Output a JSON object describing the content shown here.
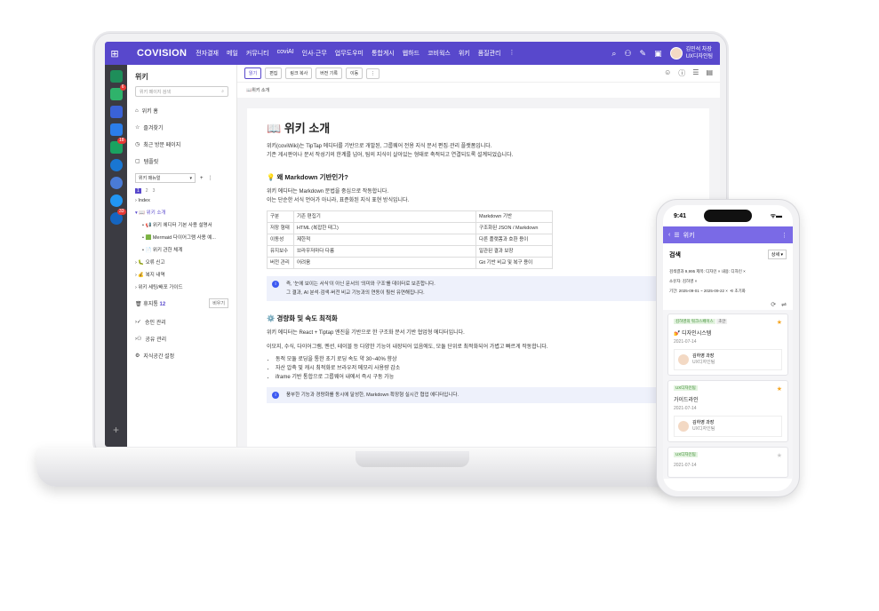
{
  "app": {
    "logo": "COVISION",
    "menu": [
      "전자결재",
      "메일",
      "커뮤니티",
      "coviAI",
      "인사·근무",
      "업무도우미",
      "통합게시",
      "웹하드",
      "코비웍스",
      "위키",
      "품질관리"
    ],
    "more": "⋮",
    "user_name": "김민석 차장",
    "user_dept": "UX디자인팀",
    "accent": "#5848cc"
  },
  "dock": {
    "badges": [
      "6",
      "18",
      "33"
    ]
  },
  "nav": {
    "title": "위키",
    "search_placeholder": "위키 페이지 검색",
    "items": [
      "위키 홈",
      "즐겨찾기",
      "최근 방문 페이지",
      "템플릿"
    ],
    "menu_select": "위키 매뉴얼",
    "pages": [
      "1",
      "2",
      "3"
    ],
    "tree": [
      "Index",
      "위키 소개",
      "위키 에디터 기본 사용 설명서",
      "Mermaid 다이어그램 사용 예...",
      "위키 관한 체계",
      "오류 신고",
      "복지 내역",
      "위키 세팅/배포 가이드"
    ],
    "trash_label": "휴지통",
    "trash_count": "12",
    "trash_button": "비우기",
    "bottom_items": [
      "승인 관리",
      "공유 관리",
      "지식공간 설정"
    ]
  },
  "toolbar": {
    "buttons": [
      "읽기",
      "편집",
      "링크 복사",
      "버전 기록",
      "이동"
    ],
    "more": "⋮"
  },
  "breadcrumb": "위키 소개",
  "doc": {
    "title": "위키 소개",
    "intro1": "위키(coviWiki)는 TipTap 에디터를 기반으로 개발된, 그룹웨어 전용 지식 문서 편집·관리 플랫폼입니다.",
    "intro2": "기존 게시판이나 문서 작성기의 한계를 넘어, 팀의 지식이 살아있는 형태로 축적되고 연결되도록 설계되었습니다.",
    "h_markdown": "왜 Markdown 기반인가?",
    "md1": "위키 에디터는 Markdown 문법을 중심으로 작동합니다.",
    "md2": "이는 단순한 서식 언어가 아니라, 표준화된 지식 표현 방식입니다.",
    "table": [
      [
        "구분",
        "기존 편집기",
        "Markdown 기반"
      ],
      [
        "저장 형태",
        "HTML (복잡한 태그)",
        "구조화된 JSON / Markdown"
      ],
      [
        "이동성",
        "제한적",
        "다른 플랫폼과 호환 용이"
      ],
      [
        "유지보수",
        "브라우저마다 다름",
        "일관된 결과 보장"
      ],
      [
        "버전 관리",
        "어려움",
        "Git 기반 비교 및 복구 용이"
      ]
    ],
    "note1a": "즉, '눈에 보이는 서식'이 아닌 문서의 '의미와 구조'를 데이터로 보존합니다.",
    "note1b": "그 결과, AI 분석·검색·버전 비교 기능과의 연동이 훨씬 유연해집니다.",
    "h_speed": "경량화 및 속도 최적화",
    "sp1": "위키 에디터는 React + Tiptap 엔진을 기반으로 한 구조화 문서 기반 협업형 에디터입니다.",
    "sp2": "이모지, 수식, 다이어그램, 멘션, 테이블 등 다양한 기능이 내장되어 있음에도, 모듈 단위로 최적화되어 가볍고 빠르게 작동합니다.",
    "bullets": [
      "동적 모듈 로딩을 통한 초기 로딩 속도 약 30~40% 향상",
      "자산 압축 및 캐시 최적화로 브라우저 메모리 사용량 감소",
      "iframe 기반 통합으로 그룹웨어 내에서 즉시 구동 가능"
    ],
    "note2": "풍부한 기능과 경량화를 동시에 달성한, Markdown 확장형 실시간 협업 에디터입니다."
  },
  "phone": {
    "time": "9:41",
    "header_title": "위키",
    "page_title": "검색",
    "detail_select": "상세",
    "result_line": "검색결과 9,995  제목: 디자인 ×  내용: 디자인 ×",
    "owner_line": "소유자: 김하영 ×",
    "period_line": "기간: 2025-09-01 ~ 2025-09-22 ×",
    "reset": "초기화",
    "cards": [
      {
        "tags": [
          "김하영의 워크스페이스",
          "초안"
        ],
        "title": "💅 디자인시스템",
        "date": "2021-07-14",
        "author": "김하영 과장",
        "dept": "UX디자인팀",
        "star": true
      },
      {
        "tags": [
          "UX디자인팀"
        ],
        "title": "가이드라인",
        "date": "2021-07-14",
        "author": "김하영 과장",
        "dept": "UX디자인팀",
        "star": true
      },
      {
        "tags": [
          "UX디자인팀"
        ],
        "title": "",
        "date": "2021-07-14",
        "author": "",
        "dept": "",
        "star": false
      }
    ]
  }
}
